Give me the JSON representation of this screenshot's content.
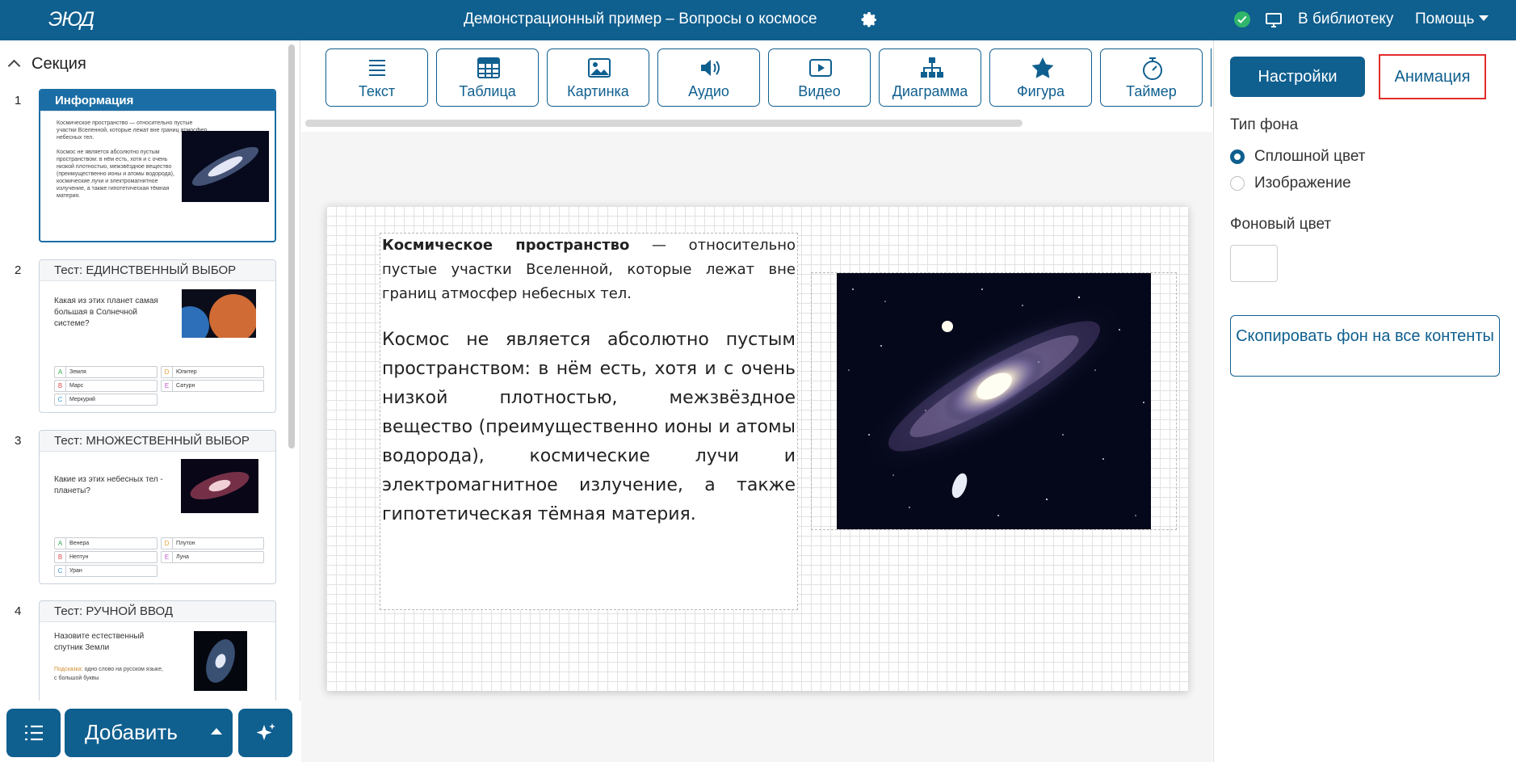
{
  "header": {
    "logo": "ЭЮД",
    "title": "Демонстрационный пример – Вопросы о космосе",
    "library_link": "В библиотеку",
    "help_menu": "Помощь"
  },
  "sidebar": {
    "section_label": "Секция",
    "slides": [
      {
        "number": "1",
        "title": "Информация",
        "text1": "Космическое пространство — относительно пустые участки Вселенной, которые лежат вне границ атмосфер небесных тел.",
        "text2": "Космос не является абсолютно пустым пространством: в нём есть, хотя и с очень низкой плотностью, межзвёздное вещество (преимущественно ионы и атомы водорода), космические лучи и электромагнитное излучение, а также гипотетическая тёмная материя."
      },
      {
        "number": "2",
        "title": "Тест: ЕДИНСТВЕННЫЙ ВЫБОР",
        "question": "Какая из этих планет самая большая в Солнечной системе?",
        "options": [
          {
            "letter": "A",
            "label": "Земля"
          },
          {
            "letter": "D",
            "label": "Юпитер"
          },
          {
            "letter": "B",
            "label": "Марс"
          },
          {
            "letter": "E",
            "label": "Сатурн"
          },
          {
            "letter": "C",
            "label": "Меркурий"
          }
        ]
      },
      {
        "number": "3",
        "title": "Тест: МНОЖЕСТВЕННЫЙ ВЫБОР",
        "question": "Какие из этих небесных тел - планеты?",
        "options": [
          {
            "letter": "A",
            "label": "Венера"
          },
          {
            "letter": "D",
            "label": "Плутон"
          },
          {
            "letter": "B",
            "label": "Нептун"
          },
          {
            "letter": "E",
            "label": "Луна"
          },
          {
            "letter": "C",
            "label": "Уран"
          }
        ]
      },
      {
        "number": "4",
        "title": "Тест: РУЧНОЙ ВВОД",
        "question": "Назовите естественный спутник Земли",
        "hint_label": "Подсказка:",
        "hint": "одно слово на русском языке, с большой буквы"
      }
    ],
    "add_button": "Добавить"
  },
  "toolbar": {
    "tools": [
      {
        "label": "Текст",
        "icon": "text-icon"
      },
      {
        "label": "Таблица",
        "icon": "table-icon"
      },
      {
        "label": "Картинка",
        "icon": "image-icon"
      },
      {
        "label": "Аудио",
        "icon": "audio-icon"
      },
      {
        "label": "Видео",
        "icon": "video-icon"
      },
      {
        "label": "Диаграмма",
        "icon": "diagram-icon"
      },
      {
        "label": "Фигура",
        "icon": "star-icon"
      },
      {
        "label": "Таймер",
        "icon": "timer-icon"
      }
    ]
  },
  "slide": {
    "term": "Космическое пространство",
    "definition_rest": " — относительно пустые участки Вселенной, которые лежат вне границ атмосфер небесных тел.",
    "paragraph": "Космос не является абсолютно пустым пространством: в нём есть, хотя и с очень низкой плотностью, межзвёздное вещество (преимущественно ионы и атомы водорода), космические лучи и электромагнитное излучение, а также гипотетическая тёмная материя."
  },
  "right_panel": {
    "settings_tab": "Настройки",
    "animation_tab": "Анимация",
    "background_type_label": "Тип фона",
    "options": [
      {
        "label": "Сплошной цвет",
        "selected": true
      },
      {
        "label": "Изображение",
        "selected": false
      }
    ],
    "background_color_label": "Фоновый цвет",
    "background_color": "#ffffff",
    "copy_button": "Скопировать фон на все контенты"
  },
  "colors": {
    "brand": "#0f5f8f",
    "status_ok": "#2fb66b",
    "highlight": "#e32b2b"
  }
}
